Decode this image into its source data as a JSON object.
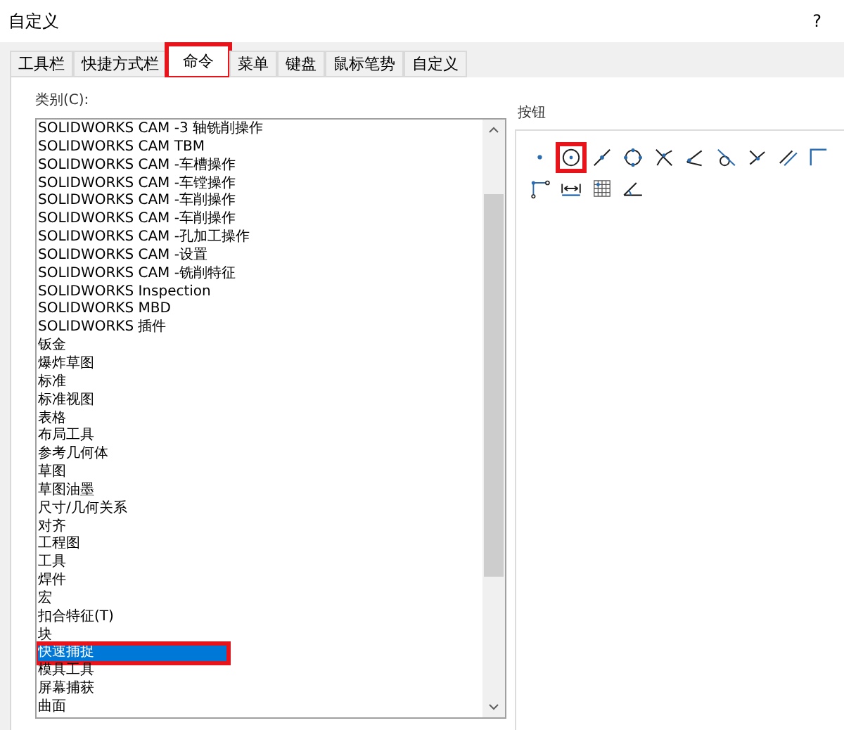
{
  "window": {
    "title": "自定义",
    "help": "?"
  },
  "tabs": [
    {
      "label": "工具栏",
      "selected": false,
      "highlighted": false
    },
    {
      "label": "快捷方式栏",
      "selected": false,
      "highlighted": false
    },
    {
      "label": "命令",
      "selected": true,
      "highlighted": true
    },
    {
      "label": "菜单",
      "selected": false,
      "highlighted": false
    },
    {
      "label": "键盘",
      "selected": false,
      "highlighted": false
    },
    {
      "label": "鼠标笔势",
      "selected": false,
      "highlighted": false
    },
    {
      "label": "自定义",
      "selected": false,
      "highlighted": false
    }
  ],
  "categories": {
    "label": "类别(C):",
    "items": [
      {
        "label": "SOLIDWORKS CAM -3 轴铣削操作",
        "selected": false,
        "highlighted": false
      },
      {
        "label": "SOLIDWORKS CAM TBM",
        "selected": false,
        "highlighted": false
      },
      {
        "label": "SOLIDWORKS CAM -车槽操作",
        "selected": false,
        "highlighted": false
      },
      {
        "label": "SOLIDWORKS CAM -车镗操作",
        "selected": false,
        "highlighted": false
      },
      {
        "label": "SOLIDWORKS CAM -车削操作",
        "selected": false,
        "highlighted": false
      },
      {
        "label": "SOLIDWORKS CAM -车削操作",
        "selected": false,
        "highlighted": false
      },
      {
        "label": "SOLIDWORKS CAM -孔加工操作",
        "selected": false,
        "highlighted": false
      },
      {
        "label": "SOLIDWORKS CAM -设置",
        "selected": false,
        "highlighted": false
      },
      {
        "label": "SOLIDWORKS CAM -铣削特征",
        "selected": false,
        "highlighted": false
      },
      {
        "label": "SOLIDWORKS Inspection",
        "selected": false,
        "highlighted": false
      },
      {
        "label": "SOLIDWORKS MBD",
        "selected": false,
        "highlighted": false
      },
      {
        "label": "SOLIDWORKS 插件",
        "selected": false,
        "highlighted": false
      },
      {
        "label": "钣金",
        "selected": false,
        "highlighted": false
      },
      {
        "label": "爆炸草图",
        "selected": false,
        "highlighted": false
      },
      {
        "label": "标准",
        "selected": false,
        "highlighted": false
      },
      {
        "label": "标准视图",
        "selected": false,
        "highlighted": false
      },
      {
        "label": "表格",
        "selected": false,
        "highlighted": false
      },
      {
        "label": "布局工具",
        "selected": false,
        "highlighted": false
      },
      {
        "label": "参考几何体",
        "selected": false,
        "highlighted": false
      },
      {
        "label": "草图",
        "selected": false,
        "highlighted": false
      },
      {
        "label": "草图油墨",
        "selected": false,
        "highlighted": false
      },
      {
        "label": "尺寸/几何关系",
        "selected": false,
        "highlighted": false
      },
      {
        "label": "对齐",
        "selected": false,
        "highlighted": false
      },
      {
        "label": "工程图",
        "selected": false,
        "highlighted": false
      },
      {
        "label": "工具",
        "selected": false,
        "highlighted": false
      },
      {
        "label": "焊件",
        "selected": false,
        "highlighted": false
      },
      {
        "label": "宏",
        "selected": false,
        "highlighted": false
      },
      {
        "label": "扣合特征(T)",
        "selected": false,
        "highlighted": false
      },
      {
        "label": "块",
        "selected": false,
        "highlighted": false
      },
      {
        "label": "快速捕捉",
        "selected": true,
        "highlighted": true
      },
      {
        "label": "模具工具",
        "selected": false,
        "highlighted": false
      },
      {
        "label": "屏幕捕获",
        "selected": false,
        "highlighted": false
      },
      {
        "label": "曲面",
        "selected": false,
        "highlighted": false
      }
    ]
  },
  "buttons": {
    "label": "按钮",
    "items": [
      {
        "kind": "point",
        "highlighted": false
      },
      {
        "kind": "center",
        "highlighted": true
      },
      {
        "kind": "midpoint",
        "highlighted": false
      },
      {
        "kind": "quadrant",
        "highlighted": false
      },
      {
        "kind": "intersection",
        "highlighted": false
      },
      {
        "kind": "nearest",
        "highlighted": false
      },
      {
        "kind": "tangent",
        "highlighted": false
      },
      {
        "kind": "perpendicular",
        "highlighted": false
      },
      {
        "kind": "parallel",
        "highlighted": false
      },
      {
        "kind": "horizontal-vertical",
        "highlighted": false
      },
      {
        "kind": "horizontal-vertical-point",
        "highlighted": false
      },
      {
        "kind": "length",
        "highlighted": false
      },
      {
        "kind": "grid",
        "highlighted": false
      },
      {
        "kind": "angle",
        "highlighted": false
      }
    ]
  }
}
